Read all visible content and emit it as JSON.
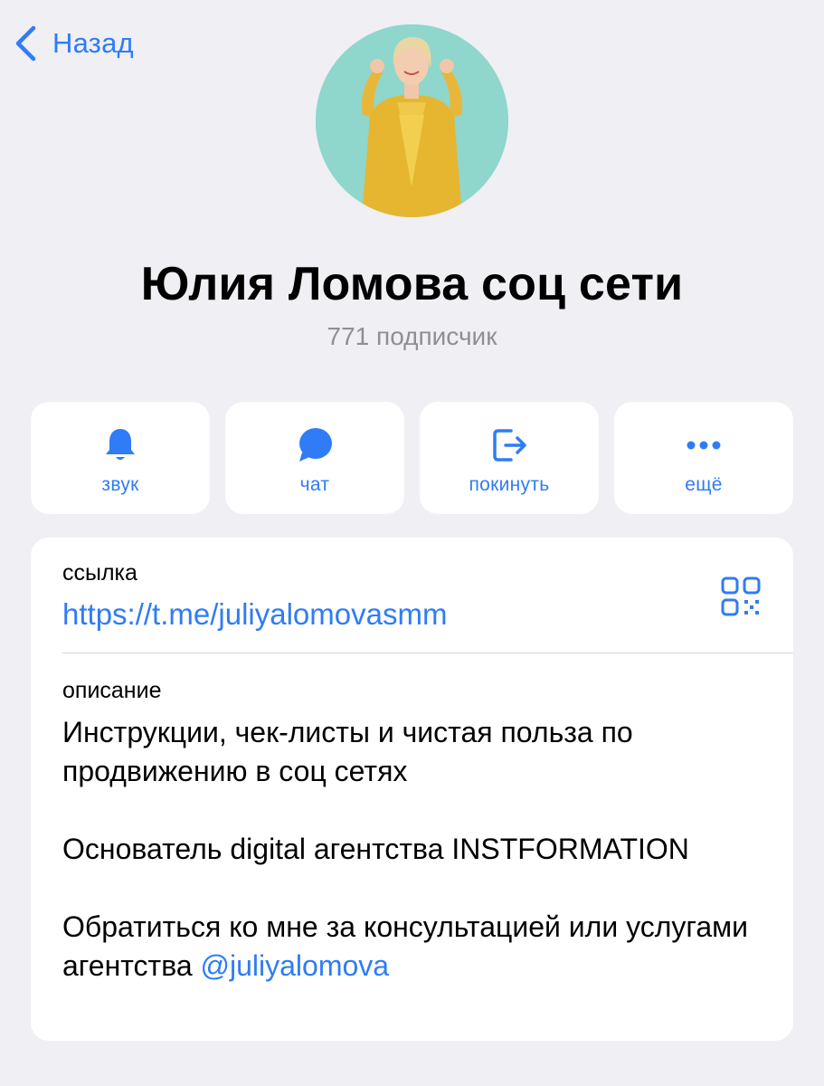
{
  "nav": {
    "back_label": "Назад"
  },
  "channel": {
    "title": "Юлия Ломова соц сети",
    "subscribers": "771 подписчик"
  },
  "actions": [
    {
      "label": "звук",
      "icon": "bell-icon"
    },
    {
      "label": "чат",
      "icon": "chat-bubble-icon"
    },
    {
      "label": "покинуть",
      "icon": "leave-icon"
    },
    {
      "label": "ещё",
      "icon": "more-dots-icon"
    }
  ],
  "info": {
    "link_label": "ссылка",
    "link_url": "https://t.me/juliyalomovasmm",
    "description_label": "описание",
    "description": {
      "line1": "Инструкции, чек-листы и чистая польза по продвижению в соц сетях",
      "line2": "Основатель digital агентства INSTFORMATION",
      "line3_text": "Обратиться ко мне за консультацией или услугами агентства ",
      "line3_mention": "@juliyalomova"
    }
  },
  "colors": {
    "accent": "#2f7cf6",
    "background": "#efeff4",
    "card": "#ffffff",
    "muted": "#8e8e93"
  }
}
